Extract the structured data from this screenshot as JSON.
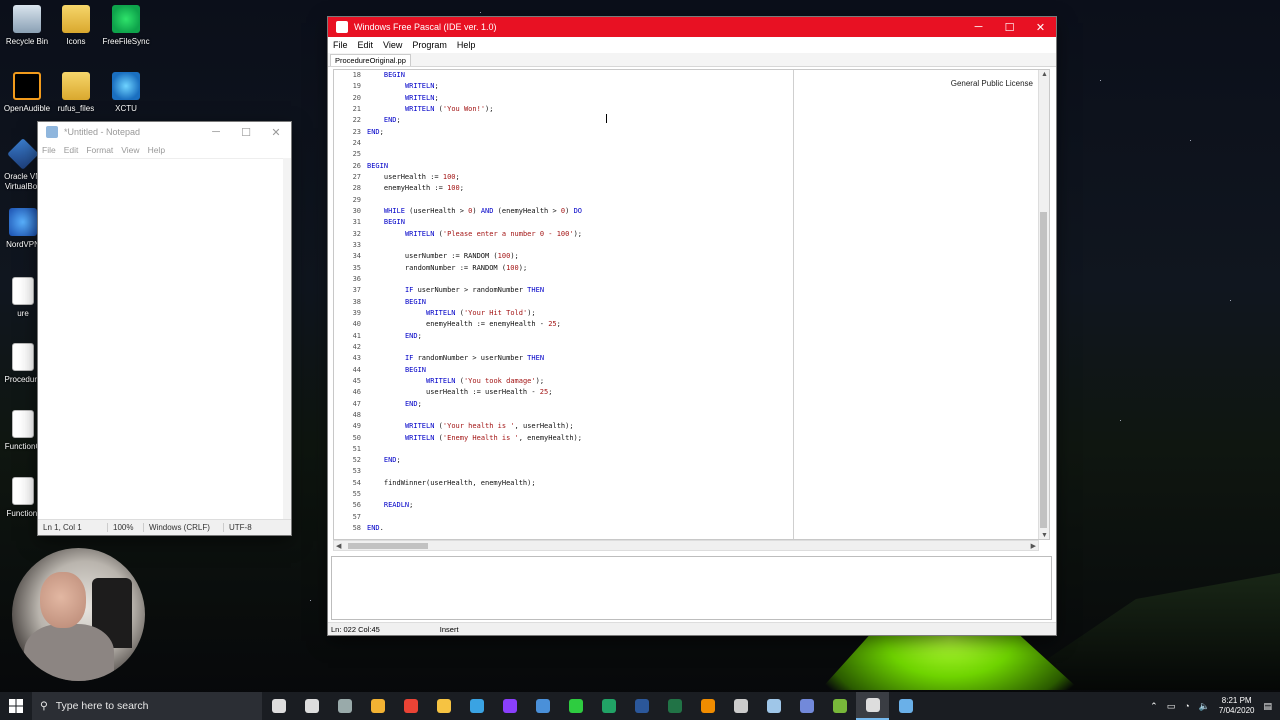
{
  "desktop": {
    "icons": [
      {
        "label": "Recycle Bin",
        "icon": "recycle-bin-icon"
      },
      {
        "label": "Icons",
        "icon": "folder-icon"
      },
      {
        "label": "FreeFileSync",
        "icon": "sync-icon"
      },
      {
        "label": "OpenAudible",
        "icon": "audible-icon"
      },
      {
        "label": "rufus_files",
        "icon": "folder-icon"
      },
      {
        "label": "XCTU",
        "icon": "xctu-icon"
      },
      {
        "label": "Oracle VM VirtualBox",
        "icon": "virtualbox-icon"
      },
      {
        "label": "NordVPN",
        "icon": "nordvpn-icon"
      },
      {
        "label": "ure",
        "icon": "document-icon"
      },
      {
        "label": "Procedure",
        "icon": "document-icon"
      },
      {
        "label": "FunctionC",
        "icon": "document-icon"
      },
      {
        "label": "Function.",
        "icon": "document-icon"
      }
    ]
  },
  "notepad": {
    "title": "*Untitled - Notepad",
    "menu": [
      "File",
      "Edit",
      "Format",
      "View",
      "Help"
    ],
    "status": {
      "position": "Ln 1, Col 1",
      "zoom": "100%",
      "eol": "Windows (CRLF)",
      "encoding": "UTF-8"
    }
  },
  "ide": {
    "title": "Windows Free Pascal  (IDE ver. 1.0)",
    "menu": [
      "File",
      "Edit",
      "View",
      "Program",
      "Help"
    ],
    "tab": "ProcedureOriginal.pp",
    "side_label": "General Public License",
    "status": {
      "position": "Ln: 022  Col:45",
      "mode": "Insert"
    },
    "code": [
      {
        "n": "18",
        "t": "    BEGIN"
      },
      {
        "n": "19",
        "t": "         WRITELN;"
      },
      {
        "n": "20",
        "t": "         WRITELN;"
      },
      {
        "n": "21",
        "t": "         WRITELN ('You Won!');"
      },
      {
        "n": "22",
        "t": "    END;"
      },
      {
        "n": "23",
        "t": "END;"
      },
      {
        "n": "24",
        "t": ""
      },
      {
        "n": "25",
        "t": ""
      },
      {
        "n": "26",
        "t": "BEGIN"
      },
      {
        "n": "27",
        "t": "    userHealth := 100;"
      },
      {
        "n": "28",
        "t": "    enemyHealth := 100;"
      },
      {
        "n": "29",
        "t": ""
      },
      {
        "n": "30",
        "t": "    WHILE (userHealth > 0) AND (enemyHealth > 0) DO"
      },
      {
        "n": "31",
        "t": "    BEGIN"
      },
      {
        "n": "32",
        "t": "         WRITELN ('Please enter a number 0 - 100');"
      },
      {
        "n": "33",
        "t": ""
      },
      {
        "n": "34",
        "t": "         userNumber := RANDOM (100);"
      },
      {
        "n": "35",
        "t": "         randomNumber := RANDOM (100);"
      },
      {
        "n": "36",
        "t": ""
      },
      {
        "n": "37",
        "t": "         IF userNumber > randomNumber THEN"
      },
      {
        "n": "38",
        "t": "         BEGIN"
      },
      {
        "n": "39",
        "t": "              WRITELN ('Your Hit Told');"
      },
      {
        "n": "40",
        "t": "              enemyHealth := enemyHealth - 25;"
      },
      {
        "n": "41",
        "t": "         END;"
      },
      {
        "n": "42",
        "t": ""
      },
      {
        "n": "43",
        "t": "         IF randomNumber > userNumber THEN"
      },
      {
        "n": "44",
        "t": "         BEGIN"
      },
      {
        "n": "45",
        "t": "              WRITELN ('You took damage');"
      },
      {
        "n": "46",
        "t": "              userHealth := userHealth - 25;"
      },
      {
        "n": "47",
        "t": "         END;"
      },
      {
        "n": "48",
        "t": ""
      },
      {
        "n": "49",
        "t": "         WRITELN ('Your health is ', userHealth);"
      },
      {
        "n": "50",
        "t": "         WRITELN ('Enemy Health is ', enemyHealth);"
      },
      {
        "n": "51",
        "t": ""
      },
      {
        "n": "52",
        "t": "    END;"
      },
      {
        "n": "53",
        "t": ""
      },
      {
        "n": "54",
        "t": "    findWinner(userHealth, enemyHealth);"
      },
      {
        "n": "55",
        "t": ""
      },
      {
        "n": "56",
        "t": "    READLN;"
      },
      {
        "n": "57",
        "t": ""
      },
      {
        "n": "58",
        "t": "END."
      }
    ]
  },
  "taskbar": {
    "search_placeholder": "Type here to search",
    "apps": [
      "cortana-icon",
      "task-view-icon",
      "app-icon",
      "store-icon",
      "chrome-icon",
      "explorer-icon",
      "xmind-icon",
      "purple-app-icon",
      "virtualbox-icon",
      "freefilesync-icon",
      "excel-green-icon",
      "word-icon",
      "excel-icon",
      "vlc-icon",
      "calculator-icon",
      "steam-icon",
      "discord-icon",
      "utorrent-icon",
      "notepad-icon",
      "pascal-icon"
    ],
    "time": "8:21 PM",
    "date": "7/04/2020"
  }
}
